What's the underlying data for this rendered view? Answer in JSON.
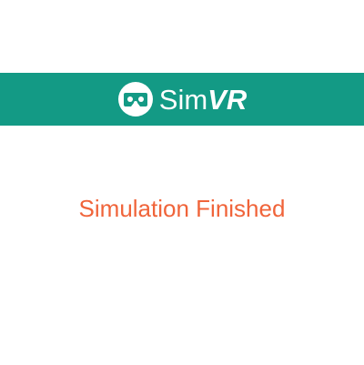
{
  "colors": {
    "header_background": "#139a85",
    "status_text": "#f0643a",
    "logo_text": "#ffffff"
  },
  "header": {
    "logo_icon": "vr-headset-icon",
    "logo_text_regular": "Sim",
    "logo_text_bold": "VR"
  },
  "main": {
    "status_message": "Simulation Finished"
  }
}
